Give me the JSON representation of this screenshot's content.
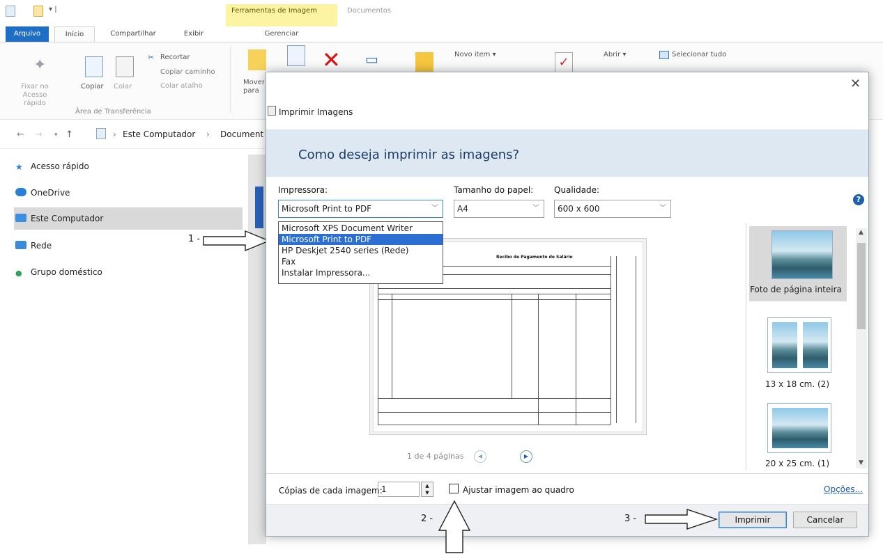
{
  "explorer": {
    "contextual_tab_title": "Ferramentas de Imagem",
    "contextual_tab_docs": "Documentos",
    "contextual_subtab": "Gerenciar",
    "tabs": [
      "Arquivo",
      "Início",
      "Compartilhar",
      "Exibir"
    ],
    "ribbon": {
      "pin_label": "Fixar no Acesso rápido",
      "copy_label": "Copiar",
      "paste_label": "Colar",
      "cut_label": "Recortar",
      "copy_path_label": "Copiar caminho",
      "paste_shortcut_label": "Colar atalho",
      "clipboard_group": "Área de Transferência",
      "move_label": "Mover para",
      "new_item_label": "Novo item ▾",
      "open_label": "Abrir ▾",
      "select_all_label": "Selecionar tudo"
    },
    "breadcrumb": [
      "Este Computador",
      "Document"
    ],
    "nav_items": [
      "Acesso rápido",
      "OneDrive",
      "Este Computador",
      "Rede",
      "Grupo doméstico"
    ]
  },
  "annotations": {
    "step1": "1 -",
    "step2": "2 -",
    "step3": "3 -"
  },
  "dialog": {
    "title": "Imprimir Imagens",
    "heading": "Como deseja imprimir as imagens?",
    "printer_label": "Impressora:",
    "printer_value": "Microsoft Print to PDF",
    "paper_label": "Tamanho do papel:",
    "paper_value": "A4",
    "quality_label": "Qualidade:",
    "quality_value": "600 x 600",
    "printer_options": [
      "Microsoft XPS Document Writer",
      "Microsoft Print to PDF",
      "HP Deskjet 2540 series (Rede)",
      "Fax",
      "Instalar Impressora..."
    ],
    "selected_printer_index": 1,
    "preview_doc_title": "Recibo de Pagamento de Salário",
    "pager_text": "1 de 4 páginas",
    "layouts": [
      "Foto de página inteira",
      "13 x 18 cm. (2)",
      "20 x 25 cm. (1)"
    ],
    "copies_label": "Cópias de cada imagem:",
    "copies_value": "1",
    "fit_label": "Ajustar imagem ao quadro",
    "fit_checked": false,
    "options_link": "Opções...",
    "print_button": "Imprimir",
    "cancel_button": "Cancelar"
  },
  "icons": [
    "pin-icon",
    "copy-icon",
    "paste-icon",
    "cut-icon",
    "move-icon",
    "delete-icon",
    "help-icon",
    "close-icon",
    "printer-icon",
    "prev-page-icon",
    "next-page-icon"
  ]
}
